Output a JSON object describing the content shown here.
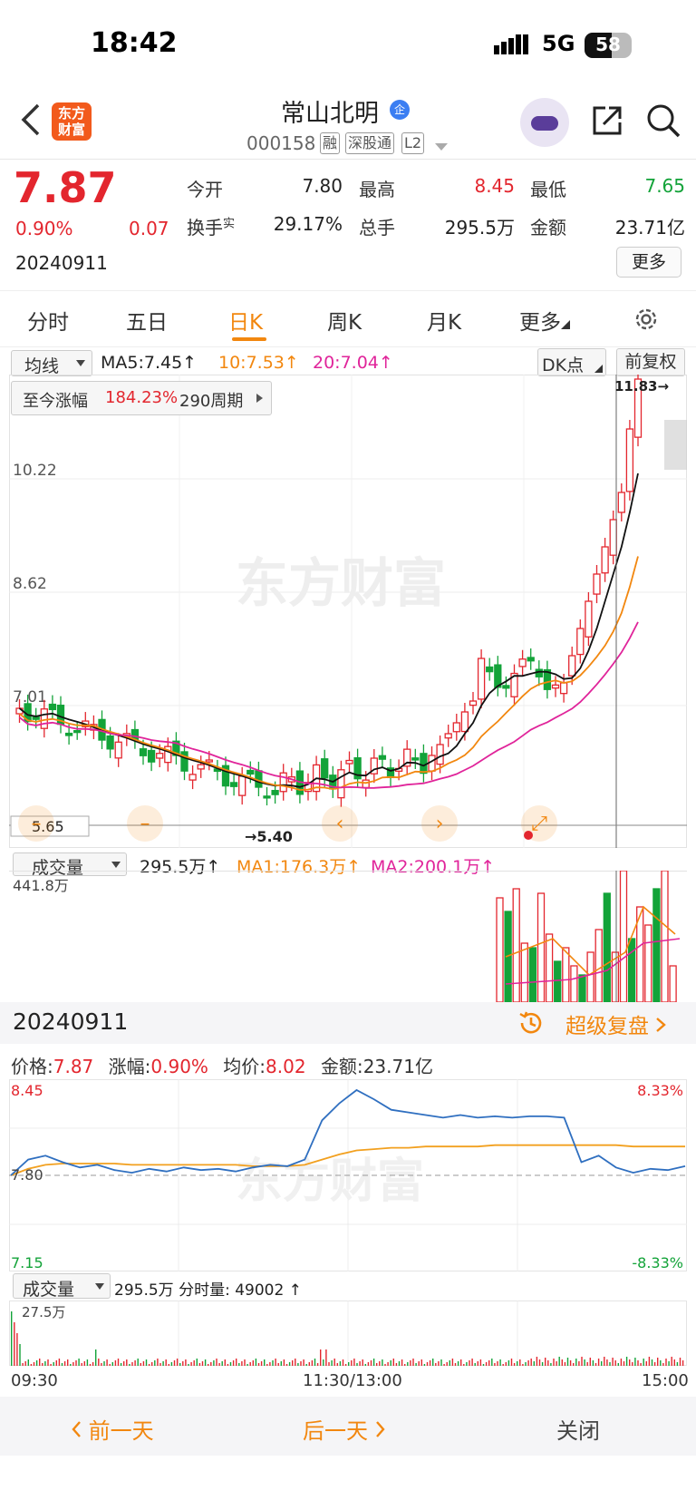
{
  "status": {
    "time": "18:42",
    "network": "5G",
    "battery": "58"
  },
  "header": {
    "logo": [
      "东方",
      "财富"
    ],
    "stock_name": "常山北明",
    "verified_badge": "企",
    "stock_code": "000158",
    "tags": [
      "融",
      "深股通",
      "L2"
    ]
  },
  "quote": {
    "price": "7.87",
    "change_pct": "0.90%",
    "change": "0.07",
    "date": "20240911",
    "open_label": "今开",
    "open": "7.80",
    "high_label": "最高",
    "high": "8.45",
    "low_label": "最低",
    "low": "7.65",
    "turnover_label": "换手",
    "turnover_sup": "实",
    "turnover": "29.17%",
    "volume_label": "总手",
    "volume": "295.5万",
    "amount_label": "金额",
    "amount": "23.71亿",
    "more_button": "更多",
    "colors": {
      "up": "#e3262e",
      "down": "#13a339"
    }
  },
  "tabs": [
    "分时",
    "五日",
    "日K",
    "周K",
    "月K",
    "更多"
  ],
  "active_tab": "日K",
  "kline": {
    "ma_select": "均线",
    "ma5": "MA5:7.45↑",
    "ma10": "10:7.53↑",
    "ma20": "20:7.04↑",
    "dk_button": "DK点",
    "adjust_button": "前复权",
    "gain_label": "至今涨幅",
    "gain_value": "184.23%",
    "gain_period": "290周期",
    "max_label": "11.83→",
    "min_label": "5.40",
    "crosshair_value": "5.65",
    "watermark": "东方财富",
    "y_ticks": [
      "10.22",
      "8.62",
      "7.01"
    ]
  },
  "volume": {
    "select": "成交量",
    "value": "295.5万↑",
    "ma1": "MA1:176.3万↑",
    "ma2": "MA2:200.1万↑",
    "max": "441.8万"
  },
  "date_bar": {
    "date": "20240911",
    "super_review": "超级复盘"
  },
  "intraday": {
    "price_label": "价格:",
    "price": "7.87",
    "pct_label": "涨幅:",
    "pct": "0.90%",
    "avg_label": "均价:",
    "avg": "8.02",
    "amount_label": "金额:",
    "amount": "23.71亿",
    "top_price": "8.45",
    "top_pct": "8.33%",
    "mid_price": "7.80",
    "bottom_price": "7.15",
    "bottom_pct": "-8.33%",
    "vol_select": "成交量",
    "vol_info": "295.5万 分时量: 49002 ↑",
    "vol_max": "27.5万",
    "times": [
      "09:30",
      "11:30/13:00",
      "15:00"
    ]
  },
  "bottom": {
    "prev": "前一天",
    "next": "后一天",
    "close": "关闭"
  },
  "chart_data": {
    "type": "line",
    "title": "",
    "series": [
      {
        "name": "价格",
        "values": [
          7.8,
          7.92,
          7.95,
          7.9,
          7.86,
          7.88,
          7.84,
          7.82,
          7.85,
          7.83,
          7.86,
          7.84,
          7.85,
          7.83,
          7.86,
          7.88,
          7.87,
          7.92,
          8.22,
          8.35,
          8.45,
          8.38,
          8.3,
          8.28,
          8.26,
          8.24,
          8.26,
          8.24,
          8.25,
          8.24,
          8.25,
          8.25,
          8.24,
          7.9,
          7.95,
          7.86,
          7.82,
          7.85,
          7.84,
          7.87
        ]
      },
      {
        "name": "均价",
        "values": [
          7.8,
          7.85,
          7.88,
          7.89,
          7.89,
          7.89,
          7.89,
          7.88,
          7.88,
          7.88,
          7.88,
          7.88,
          7.88,
          7.88,
          7.87,
          7.87,
          7.87,
          7.88,
          7.92,
          7.96,
          7.99,
          8.0,
          8.01,
          8.01,
          8.02,
          8.02,
          8.02,
          8.02,
          8.03,
          8.03,
          8.03,
          8.03,
          8.03,
          8.03,
          8.03,
          8.03,
          8.02,
          8.02,
          8.02,
          8.02
        ]
      }
    ],
    "x": [
      "09:30",
      "11:30/13:00",
      "15:00"
    ],
    "ylim": [
      7.15,
      8.45
    ]
  }
}
